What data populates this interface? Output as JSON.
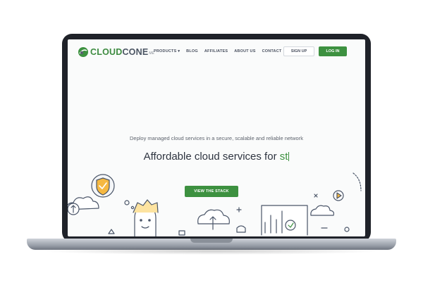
{
  "brand": {
    "part1": "CLOUD",
    "part2": "CONE",
    "suffix": "ME"
  },
  "nav": {
    "items": [
      "PRODUCTS",
      "BLOG",
      "AFFILIATES",
      "ABOUT US",
      "CONTACT"
    ],
    "products_chevron": "▾",
    "signup_label": "SIGN UP",
    "login_label": "LOG IN"
  },
  "hero": {
    "tagline": "Deploy managed cloud services in a secure, scalable and reliable network",
    "headline_static": "Affordable cloud services for ",
    "headline_typed": "st",
    "cta_label": "VIEW THE STACK"
  },
  "colors": {
    "accent": "#3d9140",
    "text": "#2e3440",
    "muted": "#5d636d",
    "frame": "#1f2229"
  },
  "icons": [
    "logo-mark-icon",
    "shield-check-icon",
    "cloud-upload-icon",
    "person-icon",
    "dashboard-icon",
    "play-icon",
    "check-icon"
  ]
}
